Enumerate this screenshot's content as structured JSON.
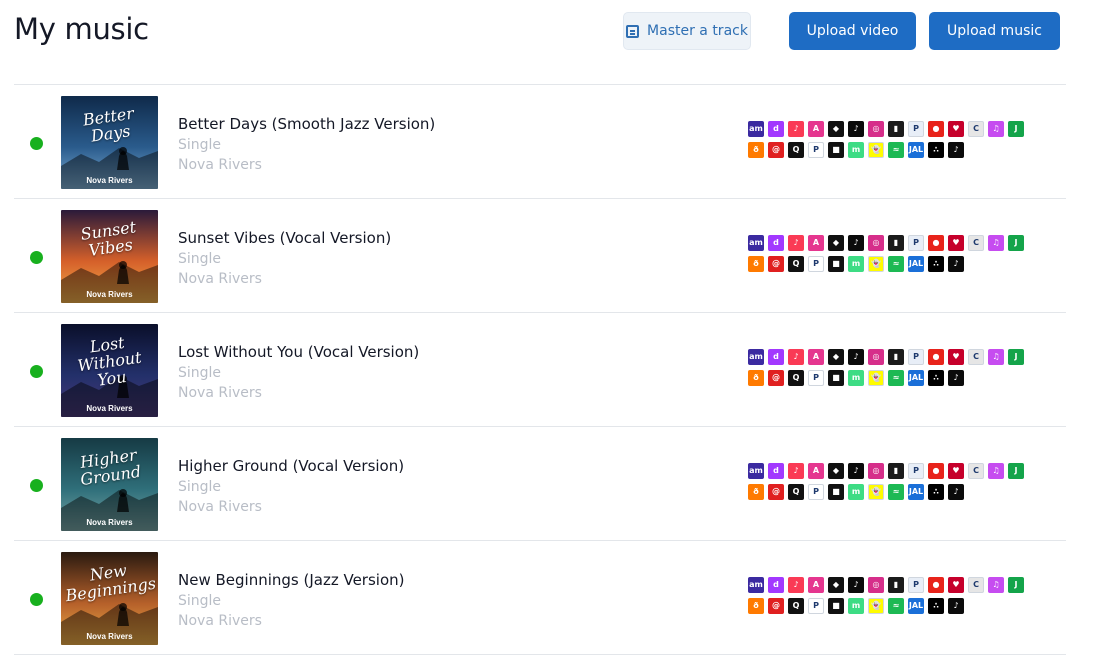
{
  "header": {
    "title": "My music",
    "master_label": "Master a track",
    "upload_video_label": "Upload video",
    "upload_music_label": "Upload music",
    "accent": "#1e6cc4"
  },
  "status_color": "#18b01e",
  "platform_icons_row1": [
    {
      "name": "amazon-music-icon",
      "bg": "#3b2aa0",
      "glyph": "am"
    },
    {
      "name": "deezer-icon",
      "bg": "#a238ff",
      "glyph": "d"
    },
    {
      "name": "apple-music-icon",
      "bg": "#fa3a55",
      "glyph": "♪"
    },
    {
      "name": "anghami-icon",
      "bg": "#e5368f",
      "glyph": "A"
    },
    {
      "name": "tidal-icon",
      "bg": "#111111",
      "glyph": "◆"
    },
    {
      "name": "tiktok-icon",
      "bg": "#0b0b0b",
      "glyph": "♪"
    },
    {
      "name": "instagram-icon",
      "bg": "#d62e8a",
      "glyph": "◎"
    },
    {
      "name": "boomplay-icon",
      "bg": "#1b1b1b",
      "glyph": "▮"
    },
    {
      "name": "pandora-icon",
      "bg": "#e8eef7",
      "glyph": "P"
    },
    {
      "name": "napster-icon",
      "bg": "#e8231b",
      "glyph": "●"
    },
    {
      "name": "iheartradio-icon",
      "bg": "#c6002b",
      "glyph": "♥"
    },
    {
      "name": "claro-musica-icon",
      "bg": "#e6e6e6",
      "glyph": "C"
    },
    {
      "name": "itunes-icon",
      "bg": "#c64cf0",
      "glyph": "♫"
    },
    {
      "name": "joox-icon",
      "bg": "#14a44a",
      "glyph": "J"
    }
  ],
  "platform_icons_row2": [
    {
      "name": "audiomack-icon",
      "bg": "#ff7a00",
      "glyph": "ð"
    },
    {
      "name": "netease-icon",
      "bg": "#e02020",
      "glyph": "@"
    },
    {
      "name": "qobuz-icon",
      "bg": "#111111",
      "glyph": "Q"
    },
    {
      "name": "pandora-p-icon",
      "bg": "#ffffff",
      "glyph": "P"
    },
    {
      "name": "roblox-icon",
      "bg": "#111111",
      "glyph": "■"
    },
    {
      "name": "anghami-green-icon",
      "bg": "#3ddc84",
      "glyph": "m"
    },
    {
      "name": "snapchat-icon",
      "bg": "#fffc00",
      "glyph": "👻"
    },
    {
      "name": "spotify-icon",
      "bg": "#1db954",
      "glyph": "≈"
    },
    {
      "name": "kkbox-icon",
      "bg": "#1a6fd8",
      "glyph": "JAL"
    },
    {
      "name": "tidal-dots-icon",
      "bg": "#000000",
      "glyph": "∴"
    },
    {
      "name": "tiktok-music-icon",
      "bg": "#0b0b0b",
      "glyph": "♪"
    }
  ],
  "tracks": [
    {
      "title": "Better Days (Smooth Jazz Version)",
      "type": "Single",
      "artist": "Nova Rivers",
      "cover_title": "Better\nDays",
      "cover_artist": "Nova Rivers"
    },
    {
      "title": "Sunset Vibes (Vocal Version)",
      "type": "Single",
      "artist": "Nova Rivers",
      "cover_title": "Sunset\nVibes",
      "cover_artist": "Nova Rivers"
    },
    {
      "title": "Lost Without You (Vocal Version)",
      "type": "Single",
      "artist": "Nova Rivers",
      "cover_title": "Lost\nWithout You",
      "cover_artist": "Nova Rivers"
    },
    {
      "title": "Higher Ground (Vocal Version)",
      "type": "Single",
      "artist": "Nova Rivers",
      "cover_title": "Higher\nGround",
      "cover_artist": "Nova Rivers"
    },
    {
      "title": "New Beginnings (Jazz Version)",
      "type": "Single",
      "artist": "Nova Rivers",
      "cover_title": "New\nBeginnings",
      "cover_artist": "Nova Rivers"
    }
  ]
}
